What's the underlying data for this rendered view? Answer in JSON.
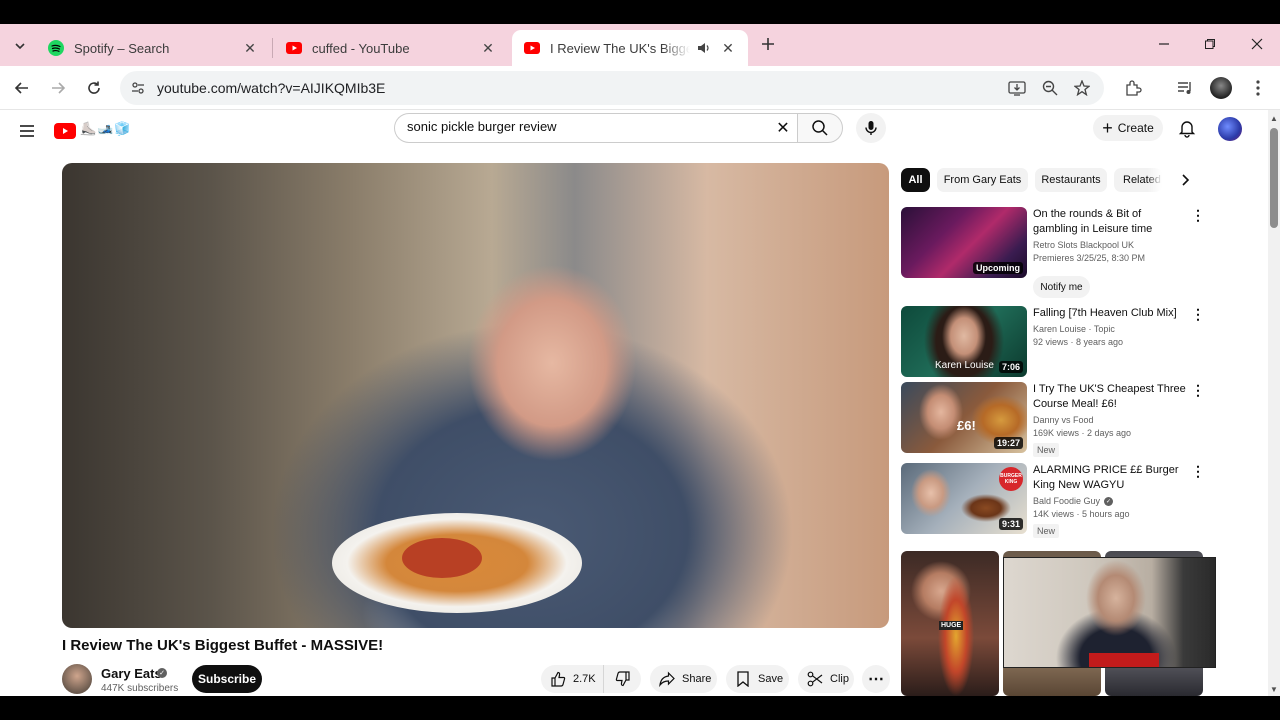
{
  "browser": {
    "tabs": [
      {
        "title": "Spotify – Search",
        "icon": "spotify-icon",
        "active": false
      },
      {
        "title": "cuffed - YouTube",
        "icon": "youtube-icon",
        "active": false
      },
      {
        "title": "I Review The UK's Biggest Buffet - MASSIVE!",
        "icon": "youtube-icon",
        "active": true,
        "audio": true
      }
    ],
    "url": "youtube.com/watch?v=AIJIKQMIb3E",
    "accent_color": "#f5d3de"
  },
  "youtube": {
    "doodle": "⛸️🎿🧊",
    "search": {
      "value": "sonic pickle burger review",
      "placeholder": "Search"
    },
    "create_label": "Create",
    "video": {
      "title": "I Review The UK's Biggest Buffet - MASSIVE!",
      "channel": "Gary Eats",
      "subscribers": "447K subscribers",
      "subscribe_label": "Subscribe",
      "likes": "2.7K",
      "share_label": "Share",
      "save_label": "Save",
      "clip_label": "Clip"
    },
    "chips": [
      "All",
      "From Gary Eats",
      "Restaurants",
      "Related"
    ],
    "recommendations": [
      {
        "title": "On the rounds & Bit of gambling in Leisure time Cleveleys",
        "channel": "Retro Slots Blackpool UK",
        "meta": "Premieres 3/25/25, 8:30 PM",
        "overlay": "Upcoming",
        "action": "Notify me"
      },
      {
        "title": "Falling [7th Heaven Club Mix]",
        "channel": "Karen Louise · Topic",
        "meta": "92 views · 8 years ago",
        "duration": "7:06",
        "thumb_text": "Karen Louise"
      },
      {
        "title": "I Try The UK'S Cheapest Three Course Meal! £6!",
        "channel": "Danny vs Food",
        "meta": "169K views · 2 days ago",
        "duration": "19:27",
        "badge": "New",
        "thumb_text": "£6!"
      },
      {
        "title": "ALARMING PRICE ££ Burger King New WAGYU WELLINGTO...",
        "channel": "Bald Foodie Guy",
        "verified": true,
        "meta": "14K views · 5 hours ago",
        "duration": "9:31",
        "badge": "New",
        "thumb_text": "BURGER KING"
      }
    ],
    "shorts_overlay_text": "HUGE"
  }
}
